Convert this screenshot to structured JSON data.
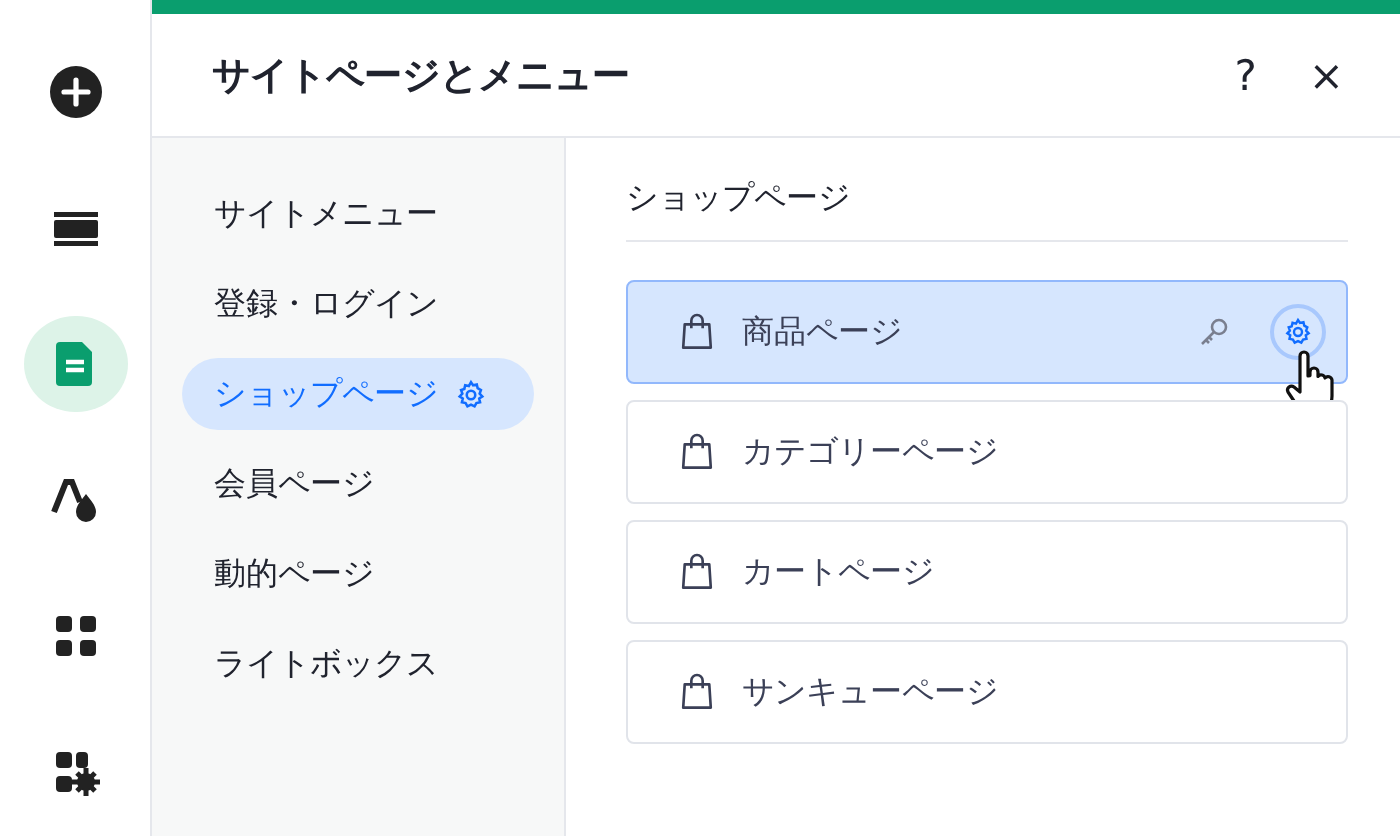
{
  "rail": [
    {
      "kind": "add",
      "selected": false
    },
    {
      "kind": "sections",
      "selected": false
    },
    {
      "kind": "pages",
      "selected": true
    },
    {
      "kind": "design",
      "selected": false
    },
    {
      "kind": "apps",
      "selected": false
    },
    {
      "kind": "business",
      "selected": false
    }
  ],
  "panel": {
    "title": "サイトページとメニュー",
    "help": "?",
    "close": "×"
  },
  "nav": [
    {
      "label": "サイトメニュー",
      "selected": false
    },
    {
      "label": "登録・ログイン",
      "selected": false
    },
    {
      "label": "ショップページ",
      "selected": true
    },
    {
      "label": "会員ページ",
      "selected": false
    },
    {
      "label": "動的ページ",
      "selected": false
    },
    {
      "label": "ライトボックス",
      "selected": false
    }
  ],
  "section_title": "ショップページ",
  "pages": [
    {
      "label": "商品ページ",
      "selected": true
    },
    {
      "label": "カテゴリーページ",
      "selected": false
    },
    {
      "label": "カートページ",
      "selected": false
    },
    {
      "label": "サンキューページ",
      "selected": false
    }
  ]
}
